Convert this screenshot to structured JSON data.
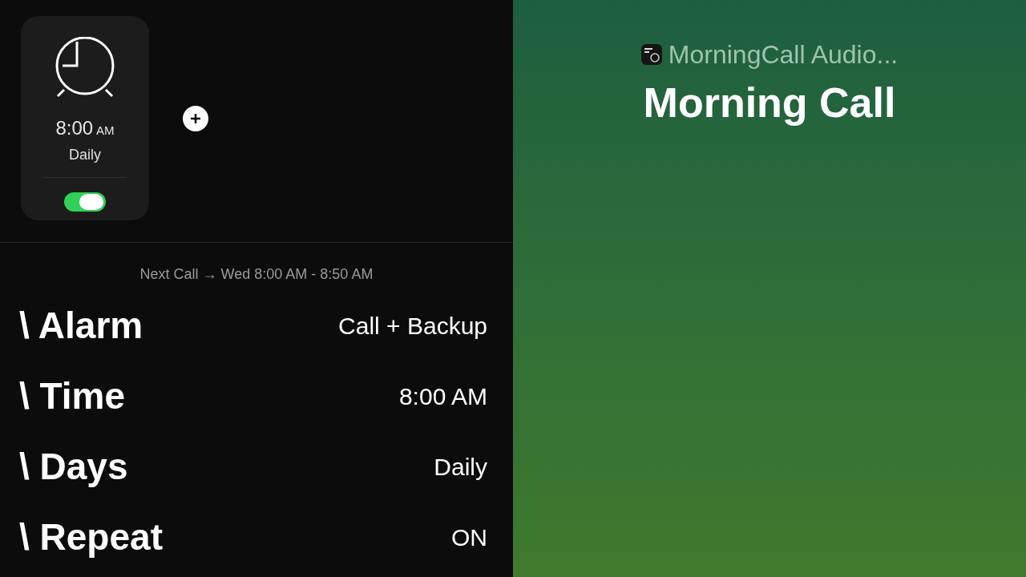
{
  "alarm_card": {
    "time": "8:00",
    "meridiem": "AM",
    "repeat": "Daily",
    "on": true
  },
  "next_call": "Next Call → Wed 8:00 AM - 8:50 AM",
  "settings": [
    {
      "label": "\\ Alarm",
      "value": "Call + Backup"
    },
    {
      "label": "\\ Time",
      "value": "8:00 AM"
    },
    {
      "label": "\\ Days",
      "value": "Daily"
    },
    {
      "label": "\\ Repeat",
      "value": "ON"
    }
  ],
  "now_playing": {
    "source": "MorningCall Audio...",
    "title": "Morning Call"
  }
}
